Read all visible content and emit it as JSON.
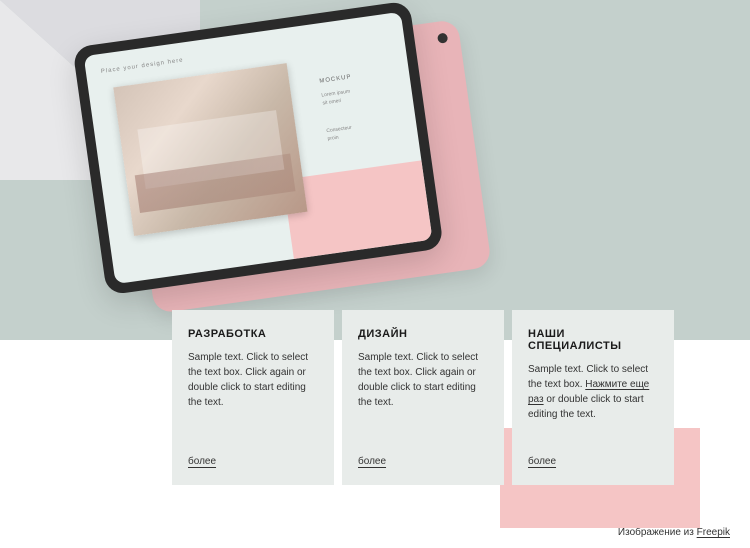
{
  "tablet": {
    "screen": {
      "label": "Place your design here",
      "sidebar": {
        "title": "MOCKUP",
        "text1": "Lorem ipsum",
        "text2": "sit omeri",
        "text3": "Consecteur",
        "text4": "proin"
      }
    }
  },
  "cards": [
    {
      "title": "РАЗРАБОТКА",
      "text": "Sample text. Click to select the text box. Click again or double click to start editing the text.",
      "link": "более"
    },
    {
      "title": "ДИЗАЙН",
      "text": "Sample text. Click to select the text box. Click again or double click to start editing the text.",
      "link": "более"
    },
    {
      "title": "НАШИ СПЕЦИАЛИСТЫ",
      "text_before": "Sample text. Click to select the text box. ",
      "inline_link": "Нажмите еще раз",
      "text_after": " or double click to start editing the text.",
      "link": "более"
    }
  ],
  "attribution": {
    "prefix": "Изображение из ",
    "source": "Freepik"
  }
}
